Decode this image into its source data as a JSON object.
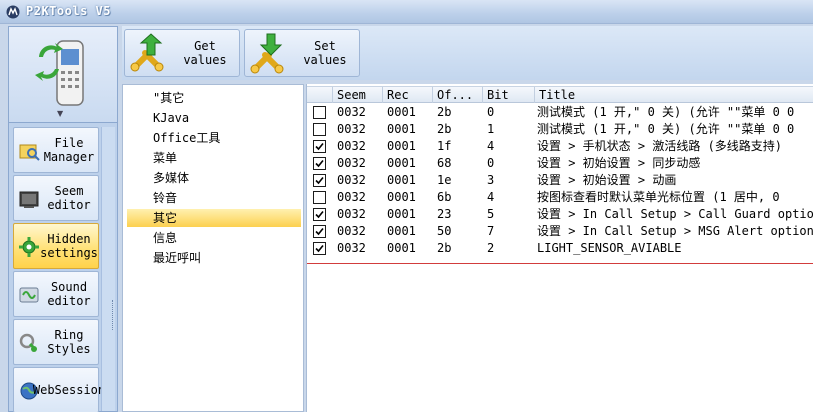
{
  "window": {
    "title": "P2KTools V5"
  },
  "sidebar": {
    "items": [
      {
        "label": "File Manager",
        "icon": "file-manager-icon",
        "active": false
      },
      {
        "label": "Seem editor",
        "icon": "seem-editor-icon",
        "active": false
      },
      {
        "label": "Hidden settings",
        "icon": "hidden-settings-icon",
        "active": true
      },
      {
        "label": "Sound editor",
        "icon": "sound-editor-icon",
        "active": false
      },
      {
        "label": "Ring Styles",
        "icon": "ring-styles-icon",
        "active": false
      },
      {
        "label": "WebSession",
        "icon": "websession-icon",
        "active": false
      }
    ]
  },
  "toolbar": {
    "get_values": "Get values",
    "set_values": "Set values"
  },
  "categories": [
    "\"其它",
    "KJava",
    "Office工具",
    "菜单",
    "多媒体",
    "铃音",
    "其它",
    "信息",
    "最近呼叫"
  ],
  "selected_category": "其它",
  "table": {
    "columns": [
      "",
      "Seem",
      "Rec",
      "Of...",
      "Bit",
      "Title"
    ],
    "rows": [
      {
        "checked": false,
        "seem": "0032",
        "rec": "0001",
        "offset": "2b",
        "bit": "0",
        "title": "测试模式 (1 开,\" 0 关) (允许 \"\"菜单 0 0"
      },
      {
        "checked": false,
        "seem": "0032",
        "rec": "0001",
        "offset": "2b",
        "bit": "1",
        "title": "测试模式 (1 开,\" 0 关) (允许 \"\"菜单 0 0"
      },
      {
        "checked": true,
        "seem": "0032",
        "rec": "0001",
        "offset": "1f",
        "bit": "4",
        "title": "设置 > 手机状态 > 激活线路 (多线路支持)"
      },
      {
        "checked": true,
        "seem": "0032",
        "rec": "0001",
        "offset": "68",
        "bit": "0",
        "title": "设置 > 初始设置 > 同步动感"
      },
      {
        "checked": true,
        "seem": "0032",
        "rec": "0001",
        "offset": "1e",
        "bit": "3",
        "title": "设置 > 初始设置 > 动画"
      },
      {
        "checked": false,
        "seem": "0032",
        "rec": "0001",
        "offset": "6b",
        "bit": "4",
        "title": "按图标查看时默认菜单光标位置 (1 居中, 0"
      },
      {
        "checked": true,
        "seem": "0032",
        "rec": "0001",
        "offset": "23",
        "bit": "5",
        "title": "设置 > In Call Setup > Call Guard option"
      },
      {
        "checked": true,
        "seem": "0032",
        "rec": "0001",
        "offset": "50",
        "bit": "7",
        "title": "设置 > In Call Setup > MSG Alert option"
      },
      {
        "checked": true,
        "seem": "0032",
        "rec": "0001",
        "offset": "2b",
        "bit": "2",
        "title": "LIGHT_SENSOR_AVIABLE"
      }
    ]
  },
  "colors": {
    "accent": "#ffd24a",
    "strike": "#d23c3c",
    "sidebar_bg": "#bdd1eb"
  }
}
